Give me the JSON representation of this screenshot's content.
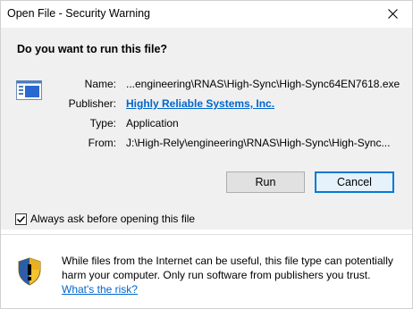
{
  "window": {
    "title": "Open File - Security Warning"
  },
  "heading": "Do you want to run this file?",
  "details": {
    "name_label": "Name:",
    "name_value": "...engineering\\RNAS\\High-Sync\\High-Sync64EN7618.exe",
    "publisher_label": "Publisher:",
    "publisher_value": "Highly Reliable Systems, Inc.",
    "type_label": "Type:",
    "type_value": "Application",
    "from_label": "From:",
    "from_value": "J:\\High-Rely\\engineering\\RNAS\\High-Sync\\High-Sync..."
  },
  "buttons": {
    "run": "Run",
    "cancel": "Cancel"
  },
  "checkbox": {
    "label": "Always ask before opening this file",
    "checked": true
  },
  "warning": {
    "text": "While files from the Internet can be useful, this file type can potentially harm your computer. Only run software from publishers you trust.",
    "link": "What's the risk?"
  },
  "colors": {
    "link": "#0066cc",
    "focus_border": "#0078d7",
    "panel": "#f0f0f0"
  },
  "icons": {
    "file": "application-file-icon",
    "shield": "security-shield-warning-icon",
    "close": "close-icon"
  }
}
